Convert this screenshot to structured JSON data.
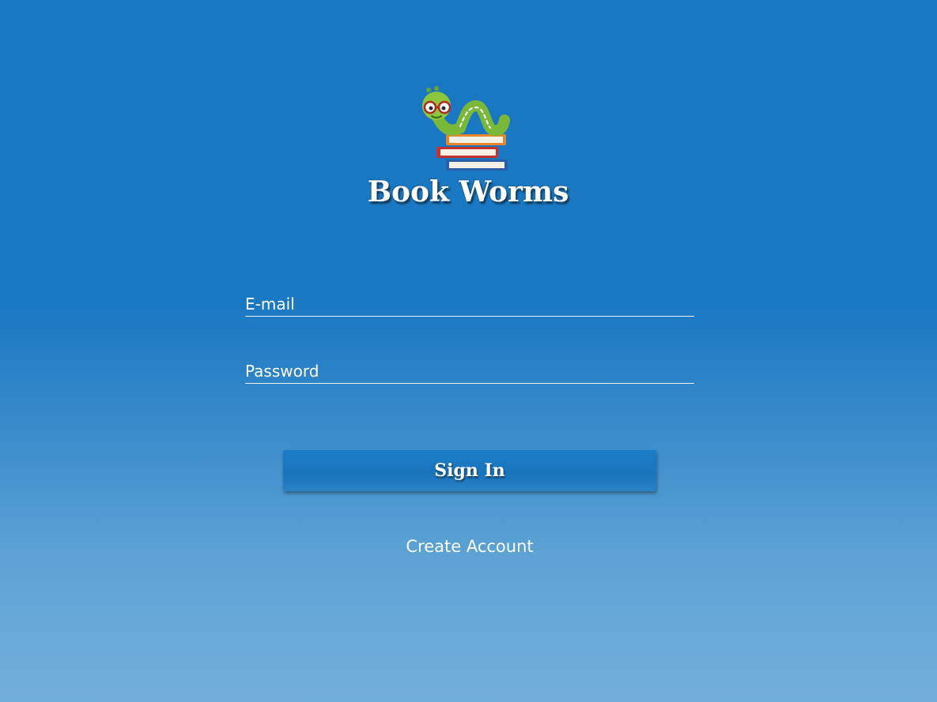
{
  "app": {
    "title": "Book Worms"
  },
  "logo": {
    "icon": "bookworm-on-books-icon"
  },
  "form": {
    "email_placeholder": "E-mail",
    "email_value": "",
    "password_placeholder": "Password",
    "password_value": "",
    "sign_in_label": "Sign In",
    "create_account_label": "Create Account"
  },
  "colors": {
    "background_top": "#1a78c2",
    "background_bottom": "#73aedb",
    "button": "#1a76c0",
    "text": "#ffffff",
    "worm_green": "#7ab83a",
    "book_orange": "#e8862a",
    "book_red": "#c8302a",
    "book_blue": "#2a5fa8"
  }
}
